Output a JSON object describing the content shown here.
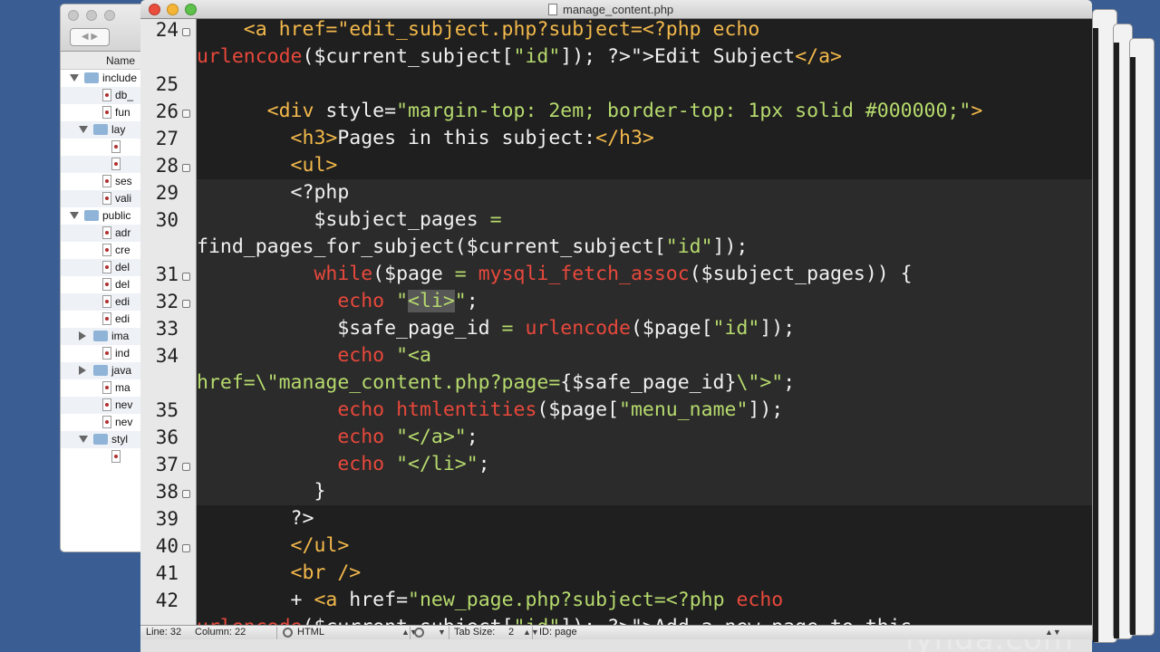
{
  "window": {
    "title": "manage_content.php"
  },
  "finder": {
    "column_header": "Name",
    "rows": [
      {
        "label": "include",
        "type": "folder",
        "indent": 0,
        "disclosure": "down"
      },
      {
        "label": "db_",
        "type": "file",
        "indent": 2
      },
      {
        "label": "fun",
        "type": "file",
        "indent": 2
      },
      {
        "label": "lay",
        "type": "folder",
        "indent": 1,
        "disclosure": "down"
      },
      {
        "label": "",
        "type": "file",
        "indent": 3
      },
      {
        "label": "",
        "type": "file",
        "indent": 3
      },
      {
        "label": "ses",
        "type": "file",
        "indent": 2
      },
      {
        "label": "vali",
        "type": "file",
        "indent": 2
      },
      {
        "label": "public",
        "type": "folder",
        "indent": 0,
        "disclosure": "down"
      },
      {
        "label": "adr",
        "type": "file",
        "indent": 2
      },
      {
        "label": "cre",
        "type": "file",
        "indent": 2
      },
      {
        "label": "del",
        "type": "file",
        "indent": 2
      },
      {
        "label": "del",
        "type": "file",
        "indent": 2
      },
      {
        "label": "edi",
        "type": "file",
        "indent": 2
      },
      {
        "label": "edi",
        "type": "file",
        "indent": 2
      },
      {
        "label": "ima",
        "type": "folder",
        "indent": 1,
        "disclosure": "right"
      },
      {
        "label": "ind",
        "type": "file",
        "indent": 2
      },
      {
        "label": "java",
        "type": "folder",
        "indent": 1,
        "disclosure": "right"
      },
      {
        "label": "ma",
        "type": "file",
        "indent": 2
      },
      {
        "label": "nev",
        "type": "file",
        "indent": 2
      },
      {
        "label": "nev",
        "type": "file",
        "indent": 2
      },
      {
        "label": "styl",
        "type": "folder",
        "indent": 1,
        "disclosure": "down"
      },
      {
        "label": "",
        "type": "file",
        "indent": 3
      }
    ]
  },
  "code_lines": [
    {
      "num": "24",
      "fold": true,
      "tokens": [
        [
          "t-tag",
          "    <a href=\"edit_subject.php?subject=<?php echo"
        ]
      ]
    },
    {
      "num": "",
      "fold": false,
      "tokens": [
        [
          "t-fn",
          "urlencode"
        ],
        [
          "t-punc",
          "($current_subject["
        ],
        [
          "t-str",
          "\"id\""
        ],
        [
          "t-punc",
          "]); ?>\">"
        ],
        [
          "t-txt",
          "Edit Subject"
        ],
        [
          "t-tag",
          "</a>"
        ]
      ]
    },
    {
      "num": "25",
      "fold": false,
      "tokens": [
        [
          "t-txt",
          ""
        ]
      ]
    },
    {
      "num": "26",
      "fold": true,
      "tokens": [
        [
          "t-tag",
          "      <div "
        ],
        [
          "t-txt",
          "style="
        ],
        [
          "t-str",
          "\"margin-top: 2em; border-top: 1px solid #000000;\""
        ],
        [
          "t-tag",
          ">"
        ]
      ]
    },
    {
      "num": "27",
      "fold": false,
      "tokens": [
        [
          "t-tag",
          "        <h3>"
        ],
        [
          "t-txt",
          "Pages in this subject:"
        ],
        [
          "t-tag",
          "</h3>"
        ]
      ]
    },
    {
      "num": "28",
      "fold": true,
      "tokens": [
        [
          "t-tag",
          "        <ul>"
        ]
      ]
    },
    {
      "num": "29",
      "fold": false,
      "hl": true,
      "tokens": [
        [
          "t-punc",
          "        <?php"
        ]
      ]
    },
    {
      "num": "30",
      "fold": false,
      "hl": true,
      "tokens": [
        [
          "t-var",
          "          $subject_pages "
        ],
        [
          "t-str",
          "="
        ]
      ]
    },
    {
      "num": "",
      "fold": false,
      "hl": true,
      "tokens": [
        [
          "t-txt",
          "find_pages_for_subject($current_subject["
        ],
        [
          "t-str",
          "\"id\""
        ],
        [
          "t-txt",
          "]);"
        ]
      ]
    },
    {
      "num": "31",
      "fold": true,
      "hl": true,
      "tokens": [
        [
          "t-kw",
          "          while"
        ],
        [
          "t-punc",
          "("
        ],
        [
          "t-var",
          "$page "
        ],
        [
          "t-str",
          "= "
        ],
        [
          "t-fn",
          "mysqli_fetch_assoc"
        ],
        [
          "t-punc",
          "($subject_pages)) {"
        ]
      ]
    },
    {
      "num": "32",
      "fold": true,
      "hl": true,
      "tokens": [
        [
          "t-kw",
          "            echo "
        ],
        [
          "t-str",
          "\""
        ],
        [
          "t-sel",
          "<li>"
        ],
        [
          "t-str",
          "\""
        ],
        [
          "t-punc",
          ";"
        ]
      ]
    },
    {
      "num": "33",
      "fold": false,
      "hl": true,
      "tokens": [
        [
          "t-var",
          "            $safe_page_id "
        ],
        [
          "t-str",
          "= "
        ],
        [
          "t-fn",
          "urlencode"
        ],
        [
          "t-punc",
          "($page["
        ],
        [
          "t-str",
          "\"id\""
        ],
        [
          "t-punc",
          "]);"
        ]
      ]
    },
    {
      "num": "34",
      "fold": false,
      "hl": true,
      "tokens": [
        [
          "t-kw",
          "            echo "
        ],
        [
          "t-str",
          "\"<a"
        ]
      ]
    },
    {
      "num": "",
      "fold": false,
      "hl": true,
      "tokens": [
        [
          "t-str",
          "href=\\\"manage_content.php?page="
        ],
        [
          "t-punc",
          "{$safe_page_id}"
        ],
        [
          "t-str",
          "\\\">\""
        ],
        [
          "t-punc",
          ";"
        ]
      ]
    },
    {
      "num": "35",
      "fold": false,
      "hl": true,
      "tokens": [
        [
          "t-kw",
          "            echo "
        ],
        [
          "t-fn",
          "htmlentities"
        ],
        [
          "t-punc",
          "($page["
        ],
        [
          "t-str",
          "\"menu_name\""
        ],
        [
          "t-punc",
          "]);"
        ]
      ]
    },
    {
      "num": "36",
      "fold": false,
      "hl": true,
      "tokens": [
        [
          "t-kw",
          "            echo "
        ],
        [
          "t-str",
          "\"</a>\""
        ],
        [
          "t-punc",
          ";"
        ]
      ]
    },
    {
      "num": "37",
      "fold": true,
      "hl": true,
      "tokens": [
        [
          "t-kw",
          "            echo "
        ],
        [
          "t-str",
          "\"</li>\""
        ],
        [
          "t-punc",
          ";"
        ]
      ]
    },
    {
      "num": "38",
      "fold": true,
      "hl": true,
      "tokens": [
        [
          "t-punc",
          "          }"
        ]
      ]
    },
    {
      "num": "39",
      "fold": false,
      "tokens": [
        [
          "t-punc",
          "        ?>"
        ]
      ]
    },
    {
      "num": "40",
      "fold": true,
      "tokens": [
        [
          "t-tag",
          "        </ul>"
        ]
      ]
    },
    {
      "num": "41",
      "fold": false,
      "tokens": [
        [
          "t-tag",
          "        <br />"
        ]
      ]
    },
    {
      "num": "42",
      "fold": false,
      "tokens": [
        [
          "t-txt",
          "        + "
        ],
        [
          "t-tag",
          "<a "
        ],
        [
          "t-txt",
          "href="
        ],
        [
          "t-str",
          "\"new_page.php?subject=<?php "
        ],
        [
          "t-kw",
          "echo"
        ]
      ]
    },
    {
      "num": "",
      "fold": false,
      "tokens": [
        [
          "t-fn",
          "urlencode"
        ],
        [
          "t-punc",
          "($current_subject["
        ],
        [
          "t-str",
          "\"id\""
        ],
        [
          "t-punc",
          "]); ?>\">"
        ],
        [
          "t-txt",
          "Add a new page to this"
        ]
      ]
    }
  ],
  "status_bar": {
    "line": "Line: 32",
    "column": "Column: 22",
    "language": "HTML",
    "tab_size": "Tab Size:",
    "tab_value": "2",
    "symbol": "ID: page"
  },
  "watermark": "lynda.com"
}
